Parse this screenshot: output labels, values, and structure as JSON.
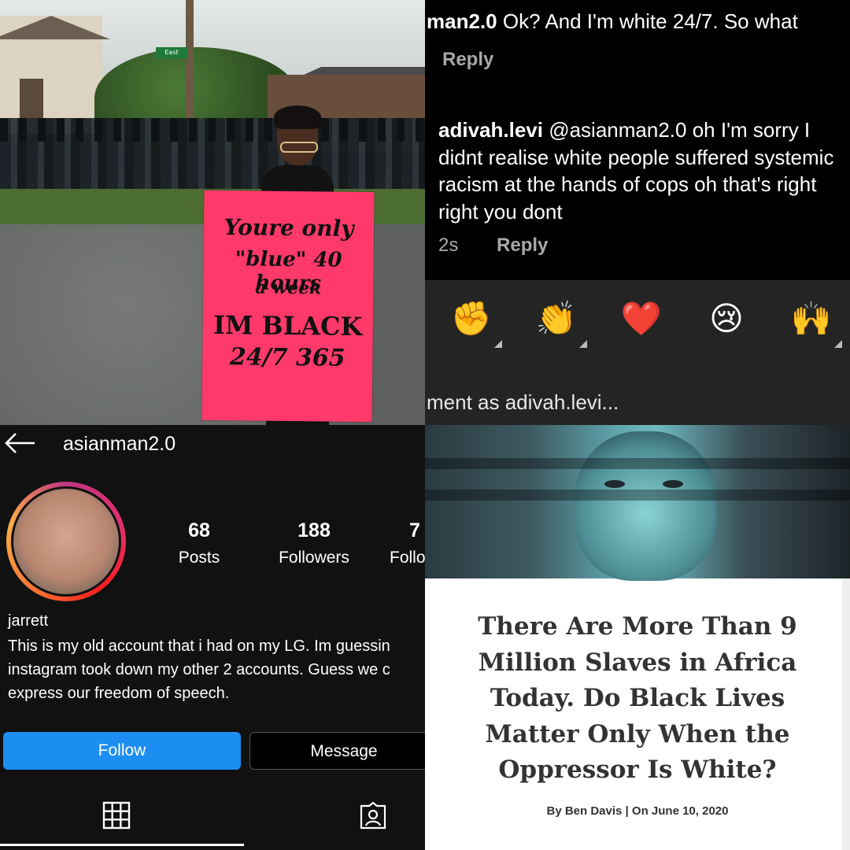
{
  "photo": {
    "street_sign": "East",
    "sign_lines": [
      "Youre only",
      "\"blue\" 40 hours",
      "a week",
      "IM BLACK",
      "24/7 365"
    ]
  },
  "comments": {
    "comment1": {
      "user": "man2.0",
      "text": "Ok? And I'm white 24/7. So what"
    },
    "reply_label": "Reply",
    "comment2": {
      "user": "adivah.levi",
      "mention": "@asianman2.0",
      "text": "oh I'm sorry I didnt realise white people suffered systemic racism at the hands of cops oh that's right right you dont"
    },
    "time": "2s",
    "emojis": [
      "✊",
      "👏",
      "❤️",
      "😢",
      "🙌"
    ],
    "input_placeholder": "ment as adivah.levi..."
  },
  "profile": {
    "back_icon": "arrow-left-icon",
    "username": "asianman2.0",
    "stats": [
      {
        "value": "68",
        "label": "Posts"
      },
      {
        "value": "188",
        "label": "Followers"
      },
      {
        "value": "7",
        "label": "Follo"
      }
    ],
    "name": "jarrett",
    "bio_lines": [
      "This is my old account that i had on my LG. Im guessin",
      "instagram took down my other 2 accounts. Guess we c",
      "express our freedom of speech."
    ],
    "follow_label": "Follow",
    "message_label": "Message"
  },
  "article": {
    "headline": "There Are More Than 9 Million Slaves in Africa Today. Do Black Lives Matter Only When the Oppressor Is White?",
    "byline": "By Ben Davis | On June 10, 2020"
  }
}
